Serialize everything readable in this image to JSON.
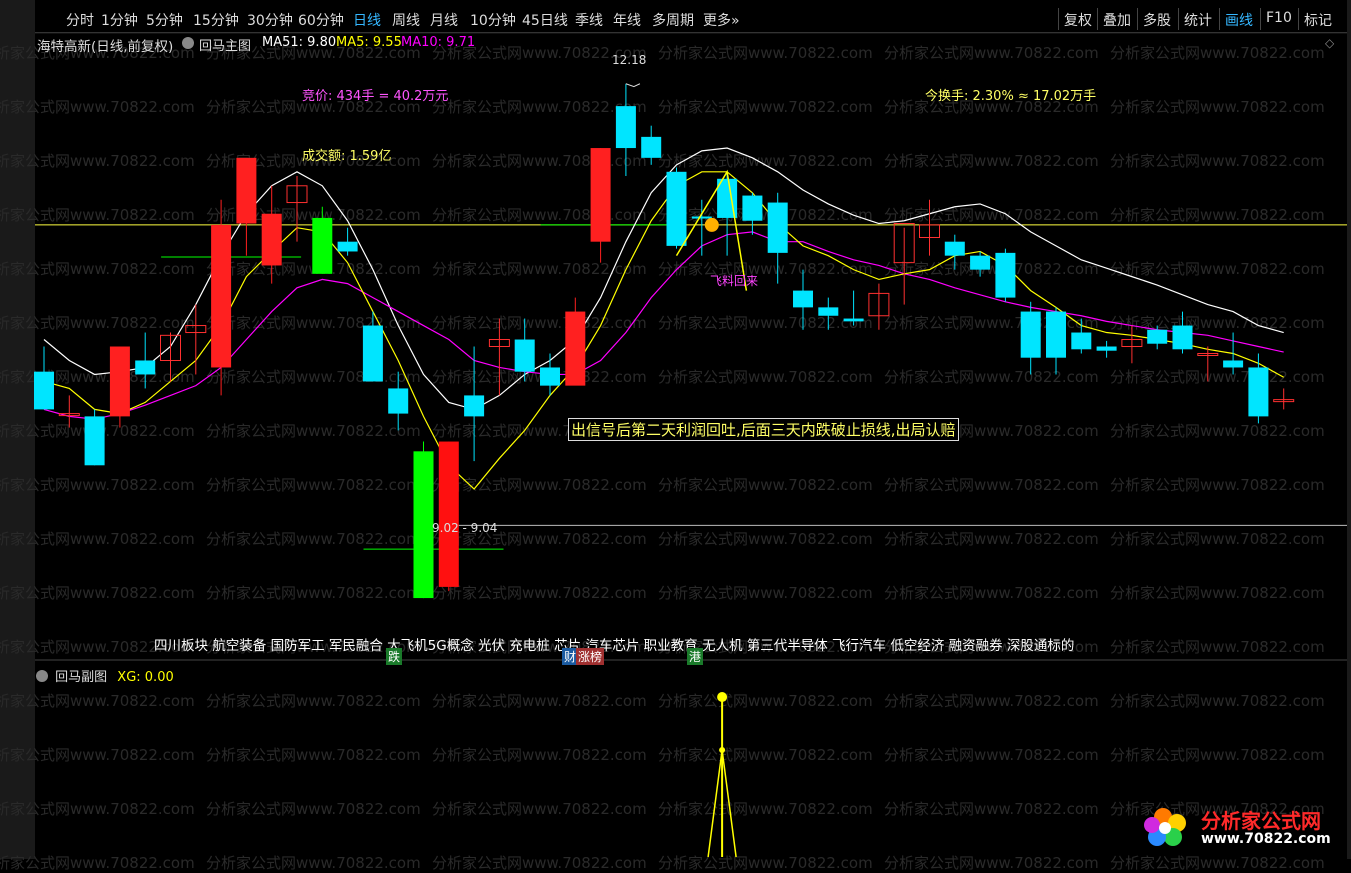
{
  "toolbar": {
    "left_tabs": [
      "分时",
      "1分钟",
      "5分钟",
      "15分钟",
      "30分钟",
      "60分钟",
      "日线",
      "周线",
      "月线",
      "10分钟",
      "45日线",
      "季线",
      "年线",
      "多周期",
      "更多»"
    ],
    "active_tab": "日线",
    "right_tabs": [
      "复权",
      "叠加",
      "多股",
      "统计",
      "画线",
      "F10",
      "标记"
    ],
    "active_right_tab": "画线"
  },
  "main_header": {
    "stock_title": "海特高新(日线,前复权)",
    "indicator_name": "回马主图",
    "ma51": "MA51: 9.80",
    "ma5": "MA5: 9.55",
    "ma10": "MA10: 9.71"
  },
  "annotations": {
    "bid": "竞价: 434手 = 40.2万元",
    "turnover_amount": "成交额: 1.59亿",
    "turnover_rate": "今换手: 2.30% ≈ 17.02万手",
    "high_label": "12.18",
    "low_label": "9.02 - 9.04",
    "signal_note": "出信号后第二天利润回吐,后面三天内跌破止损线,出局认赔",
    "flying_text": "飞料回来"
  },
  "concepts": "四川板块 航空装备 国防军工 军民融合 大飞机5G概念 光伏 充电桩 芯片 汽车芯片 职业教育 无人机 第三代半导体 飞行汽车 低空经济 融资融券 深股通标的",
  "tags": [
    {
      "text": "跌",
      "color": "#1a7a2a"
    },
    {
      "text": "财",
      "color": "#1a5aa0"
    },
    {
      "text": "涨榜",
      "color": "#a03030"
    },
    {
      "text": "港",
      "color": "#1a7a2a"
    }
  ],
  "sub_header": {
    "name": "回马副图",
    "xg": "XG: 0.00"
  },
  "watermark": "分析家公式网www.70822.com",
  "logo": {
    "title": "分析家公式网",
    "url": "www.70822.com"
  },
  "colors": {
    "up": "#ff2020",
    "down": "#00e5ff",
    "flat_up": "#ff3030",
    "ma5": "#ffff00",
    "ma10": "#ff00ff",
    "ma51": "#ffffff",
    "hline": "#ffff40",
    "stop_green": "#00ff00"
  },
  "chart_data": {
    "type": "candlestick",
    "price_axis": {
      "min": 8.2,
      "max": 12.35
    },
    "candles": [
      {
        "o": 10.12,
        "h": 10.3,
        "l": 9.85,
        "c": 9.85
      },
      {
        "o": 9.82,
        "h": 9.95,
        "l": 9.72,
        "c": 9.82
      },
      {
        "o": 9.8,
        "h": 9.85,
        "l": 9.45,
        "c": 9.45
      },
      {
        "o": 9.8,
        "h": 10.3,
        "l": 9.72,
        "c": 10.3
      },
      {
        "o": 10.2,
        "h": 10.4,
        "l": 10.0,
        "c": 10.1
      },
      {
        "o": 10.2,
        "h": 10.4,
        "l": 10.05,
        "c": 10.38
      },
      {
        "o": 10.4,
        "h": 10.6,
        "l": 10.1,
        "c": 10.45
      },
      {
        "o": 10.15,
        "h": 11.35,
        "l": 9.95,
        "c": 11.17
      },
      {
        "o": 11.18,
        "h": 11.62,
        "l": 10.95,
        "c": 11.65
      },
      {
        "o": 10.88,
        "h": 11.45,
        "l": 10.75,
        "c": 11.25
      },
      {
        "o": 11.33,
        "h": 11.52,
        "l": 11.05,
        "c": 11.45
      },
      {
        "o": 11.22,
        "h": 11.3,
        "l": 10.82,
        "c": 10.82
      },
      {
        "o": 11.05,
        "h": 11.15,
        "l": 10.95,
        "c": 10.98
      },
      {
        "o": 10.45,
        "h": 10.55,
        "l": 10.05,
        "c": 10.05
      },
      {
        "o": 10.0,
        "h": 10.12,
        "l": 9.7,
        "c": 9.82
      },
      {
        "o": 9.55,
        "h": 9.62,
        "l": 8.5,
        "c": 8.5
      },
      {
        "o": 8.58,
        "h": 9.62,
        "l": 8.55,
        "c": 9.62
      },
      {
        "o": 9.95,
        "h": 10.3,
        "l": 9.48,
        "c": 9.8
      },
      {
        "o": 10.3,
        "h": 10.5,
        "l": 9.95,
        "c": 10.35
      },
      {
        "o": 10.35,
        "h": 10.5,
        "l": 10.05,
        "c": 10.12
      },
      {
        "o": 10.15,
        "h": 10.25,
        "l": 9.95,
        "c": 10.02
      },
      {
        "o": 10.02,
        "h": 10.65,
        "l": 10.15,
        "c": 10.55
      },
      {
        "o": 11.05,
        "h": 11.72,
        "l": 10.9,
        "c": 11.72
      },
      {
        "o": 12.02,
        "h": 12.18,
        "l": 11.52,
        "c": 11.72
      },
      {
        "o": 11.8,
        "h": 11.88,
        "l": 11.6,
        "c": 11.65
      },
      {
        "o": 11.55,
        "h": 11.58,
        "l": 11.0,
        "c": 11.02
      },
      {
        "o": 11.23,
        "h": 11.35,
        "l": 10.95,
        "c": 11.22
      },
      {
        "o": 11.5,
        "h": 11.55,
        "l": 10.95,
        "c": 11.22
      },
      {
        "o": 11.38,
        "h": 11.4,
        "l": 11.1,
        "c": 11.2
      },
      {
        "o": 11.33,
        "h": 11.4,
        "l": 10.75,
        "c": 10.97
      },
      {
        "o": 10.7,
        "h": 10.85,
        "l": 10.42,
        "c": 10.58
      },
      {
        "o": 10.58,
        "h": 10.65,
        "l": 10.42,
        "c": 10.52
      },
      {
        "o": 10.5,
        "h": 10.7,
        "l": 10.45,
        "c": 10.48
      },
      {
        "o": 10.52,
        "h": 10.75,
        "l": 10.42,
        "c": 10.68
      },
      {
        "o": 10.9,
        "h": 11.15,
        "l": 10.6,
        "c": 11.18
      },
      {
        "o": 11.08,
        "h": 11.35,
        "l": 10.95,
        "c": 11.17
      },
      {
        "o": 11.05,
        "h": 11.1,
        "l": 10.85,
        "c": 10.95
      },
      {
        "o": 10.95,
        "h": 10.98,
        "l": 10.8,
        "c": 10.85
      },
      {
        "o": 10.97,
        "h": 11.0,
        "l": 10.62,
        "c": 10.65
      },
      {
        "o": 10.55,
        "h": 10.62,
        "l": 10.1,
        "c": 10.22
      },
      {
        "o": 10.55,
        "h": 10.58,
        "l": 10.1,
        "c": 10.22
      },
      {
        "o": 10.4,
        "h": 10.5,
        "l": 10.25,
        "c": 10.28
      },
      {
        "o": 10.3,
        "h": 10.34,
        "l": 10.22,
        "c": 10.27
      },
      {
        "o": 10.3,
        "h": 10.45,
        "l": 10.18,
        "c": 10.35
      },
      {
        "o": 10.42,
        "h": 10.45,
        "l": 10.28,
        "c": 10.32
      },
      {
        "o": 10.45,
        "h": 10.55,
        "l": 10.25,
        "c": 10.28
      },
      {
        "o": 10.25,
        "h": 10.3,
        "l": 10.05,
        "c": 10.25
      },
      {
        "o": 10.2,
        "h": 10.4,
        "l": 10.1,
        "c": 10.15
      },
      {
        "o": 10.15,
        "h": 10.25,
        "l": 9.75,
        "c": 9.8
      },
      {
        "o": 9.92,
        "h": 10.0,
        "l": 9.85,
        "c": 9.92
      }
    ],
    "ma51": [
      10.35,
      10.2,
      10.1,
      10.12,
      10.15,
      10.3,
      10.6,
      10.95,
      11.25,
      11.45,
      11.55,
      11.45,
      11.2,
      10.85,
      10.45,
      10.1,
      9.9,
      9.85,
      9.95,
      10.1,
      10.2,
      10.35,
      10.65,
      11.05,
      11.4,
      11.6,
      11.7,
      11.72,
      11.65,
      11.55,
      11.42,
      11.32,
      11.24,
      11.18,
      11.2,
      11.25,
      11.3,
      11.32,
      11.25,
      11.12,
      11.02,
      10.92,
      10.86,
      10.8,
      10.74,
      10.67,
      10.6,
      10.55,
      10.45,
      10.4
    ],
    "ma5": [
      10.05,
      10.0,
      9.85,
      9.82,
      9.9,
      10.05,
      10.2,
      10.45,
      10.8,
      10.98,
      11.15,
      11.12,
      10.9,
      10.55,
      10.2,
      9.8,
      9.45,
      9.28,
      9.5,
      9.7,
      9.95,
      10.15,
      10.45,
      10.85,
      11.2,
      11.45,
      11.55,
      11.55,
      11.4,
      11.18,
      11.02,
      10.95,
      10.85,
      10.78,
      10.82,
      10.85,
      10.95,
      10.98,
      10.88,
      10.7,
      10.58,
      10.45,
      10.4,
      10.38,
      10.35,
      10.32,
      10.28,
      10.25,
      10.18,
      10.08
    ],
    "ma10": [
      9.85,
      9.8,
      9.78,
      9.82,
      9.88,
      9.95,
      10.02,
      10.15,
      10.35,
      10.55,
      10.72,
      10.78,
      10.75,
      10.65,
      10.55,
      10.45,
      10.35,
      10.2,
      10.15,
      10.12,
      10.1,
      10.1,
      10.2,
      10.4,
      10.65,
      10.85,
      11.02,
      11.1,
      11.12,
      11.05,
      11.05,
      10.98,
      10.92,
      10.88,
      10.82,
      10.78,
      10.72,
      10.67,
      10.62,
      10.58,
      10.55,
      10.52,
      10.48,
      10.45,
      10.42,
      10.4,
      10.38,
      10.34,
      10.3,
      10.26
    ],
    "horizontal_lines": [
      11.17,
      9.02
    ],
    "stop_levels": [
      {
        "index": 7,
        "value": 10.94
      },
      {
        "index": 15,
        "value": 8.85
      },
      {
        "index": 22,
        "value": 11.17
      }
    ],
    "signal_index": 27,
    "sub_chart": {
      "name": "回马副图",
      "xg_peak_index": 27,
      "xg_value": 1
    }
  }
}
